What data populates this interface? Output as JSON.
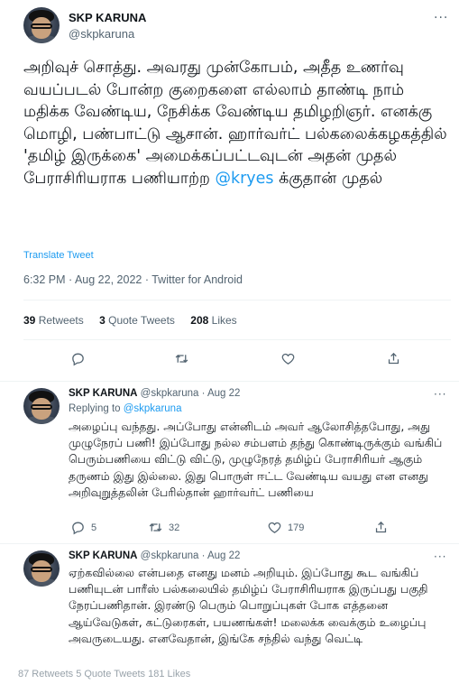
{
  "main_tweet": {
    "name": "SKP KARUNA",
    "handle": "@skpkaruna",
    "text_part1": "அறிவுச் சொத்து. அவரது முன்கோபம், அதீத உணர்வு வயப்படல் போன்ற குறைகளை எல்லாம் தாண்டி நாம் மதிக்க வேண்டிய, நேசிக்க வேண்டிய தமிழறிஞர். எனக்கு மொழி, பண்பாட்டு ஆசான். ஹார்வர்ட் பல்கலைக்கழகத்தில் 'தமிழ் இருக்கை' அமைக்கப்பட்டவுடன் அதன் முதல் பேராசிரியராக பணியாற்ற ",
    "mention": "@kryes",
    "text_part2": " க்குதான் முதல்",
    "translate": "Translate Tweet",
    "meta": "6:32 PM · Aug 22, 2022 · Twitter for Android",
    "stats": {
      "retweets_count": "39",
      "retweets_label": "Retweets",
      "quotes_count": "3",
      "quotes_label": "Quote Tweets",
      "likes_count": "208",
      "likes_label": "Likes"
    },
    "more": "···"
  },
  "replies": [
    {
      "name": "SKP KARUNA",
      "handle_time": "@skpkaruna · Aug 22",
      "replying_prefix": "Replying to ",
      "replying_handle": "@skpkaruna",
      "text": "அழைப்பு வந்தது. அப்போது என்னிடம் அவர் ஆலோசித்தபோது, அது முழுநேரப் பணி! இப்போது நல்ல சம்பளம் தந்து கொண்டிருக்கும் வங்கிப் பெரும்பணியை விட்டு விட்டு, முழுநேரத் தமிழ்ப் பேராசிரியர் ஆகும் தருணம் இது இல்லை. இது பொருள் ஈட்ட வேண்டிய வயது என எனது அறிவுறுத்தலின் பேரில்தான் ஹார்வர்ட் பணியை",
      "reply_count": "5",
      "retweet_count": "",
      "quote_count": "32",
      "like_count": "179",
      "more": "···"
    },
    {
      "name": "SKP KARUNA",
      "handle_time": "@skpkaruna · Aug 22",
      "text": "ஏற்கவில்லை என்பதை எனது மனம் அறியும். இப்போது கூட வங்கிப் பணியுடன் பாரீஸ் பல்கலையில் தமிழ்ப் பேராசிரியராக இருப்பது பகுதி நேரப்பணிதான். இரண்டு பெரும் பொறுப்புகள் போக எத்தனை ஆய்வேடுகள், கட்டுரைகள், பயணங்கள்! மலைக்க வைக்கும் உழைப்பு அவருடையது. எனவேதான், இங்கே சந்தில் வந்து வெட்டி",
      "partial_stats": "87 Retweets  5 Quote Tweets  181 Likes",
      "more": "···"
    }
  ],
  "icons": [
    "reply-icon",
    "retweet-icon",
    "like-icon",
    "share-icon",
    "more-icon"
  ],
  "colors": {
    "accent": "#1d9bf0",
    "muted": "#536471",
    "text": "#0f1419",
    "divider": "#eff3f4"
  }
}
